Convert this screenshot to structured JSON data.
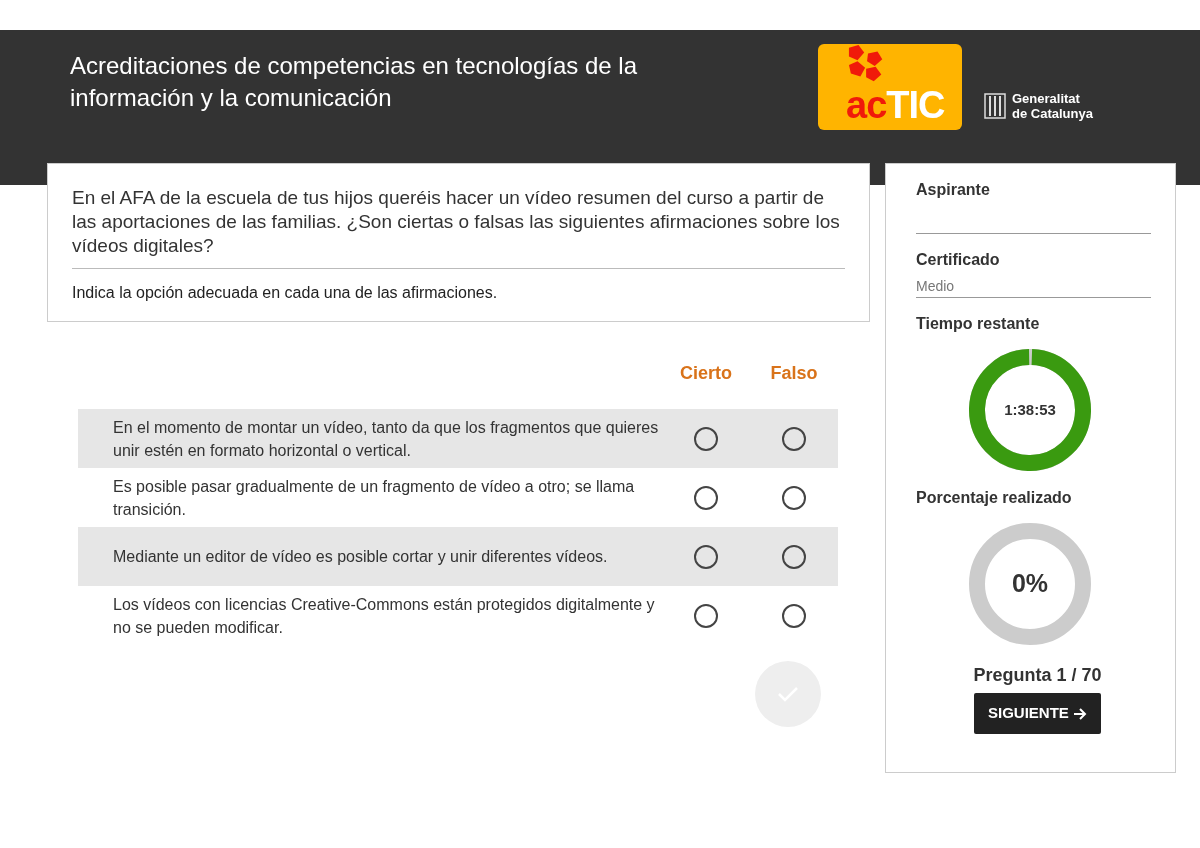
{
  "header": {
    "title": "Acreditaciones de competencias en tecnologías de la información y la comunicación",
    "logo": {
      "part_1": "ac",
      "part_2": "TIC"
    },
    "institution": [
      "Generalitat",
      "de Catalunya"
    ]
  },
  "question": {
    "text": "En el AFA de la escuela de tus hijos queréis hacer un vídeo resumen del curso a partir de las aportaciones de las familias. ¿Son ciertas o falsas las siguientes afirmaciones sobre los vídeos digitales?",
    "instruction": "Indica la opción adecuada en cada una de las afirmaciones."
  },
  "answer_columns": [
    "Cierto",
    "Falso"
  ],
  "statements": [
    {
      "text": "En el momento de montar un vídeo, tanto da que los fragmentos que quieres unir estén en formato horizontal o vertical.",
      "options": [
        {
          "selected": false
        },
        {
          "selected": false
        }
      ]
    },
    {
      "text": "Es posible pasar gradualmente de un fragmento de vídeo a otro; se llama transición.",
      "options": [
        {
          "selected": false
        },
        {
          "selected": false
        }
      ]
    },
    {
      "text": "Mediante un editor de vídeo es posible cortar y unir diferentes vídeos.",
      "options": [
        {
          "selected": false
        },
        {
          "selected": false
        }
      ]
    },
    {
      "text": "Los vídeos con licencias Creative-Commons están protegidos digitalmente y no se pueden modificar.",
      "options": [
        {
          "selected": false
        },
        {
          "selected": false
        }
      ]
    }
  ],
  "check_button": {
    "disabled": true
  },
  "sidebar": {
    "candidate_label": "Aspirante",
    "certificate_label": "Certificado",
    "certificate_value": "Medio",
    "time_label": "Tiempo restante",
    "time": {
      "kind": "timer",
      "reading": "1:38:53"
    },
    "progress_label": "Porcentaje realizado",
    "progress": {
      "kind": "percent",
      "reading": "0%"
    },
    "question_counter": "Pregunta 1 / 70",
    "next_button": "SIGUIENTE"
  }
}
